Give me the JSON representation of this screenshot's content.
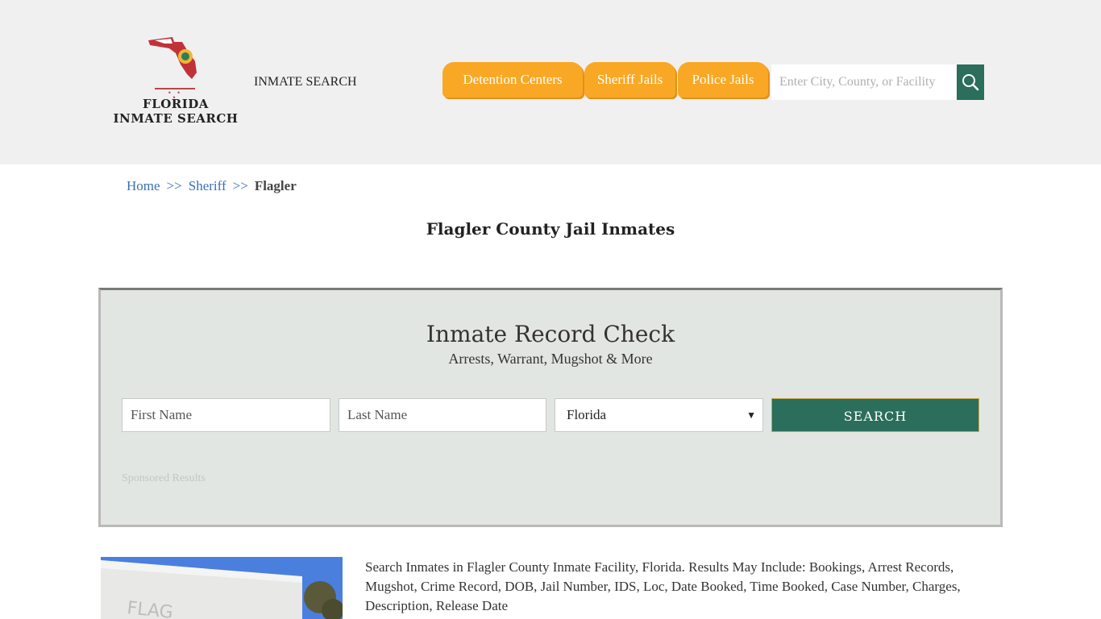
{
  "header": {
    "logo": {
      "line1": "FLORIDA",
      "line2": "INMATE SEARCH",
      "dots": "• • •"
    },
    "nav_link": "INMATE SEARCH",
    "tabs": [
      {
        "label": "Detention Centers"
      },
      {
        "label": "Sheriff Jails"
      },
      {
        "label": "Police Jails"
      }
    ],
    "search": {
      "placeholder": "Enter City, County, or Facility",
      "icon": "search-icon"
    }
  },
  "breadcrumb": {
    "home": "Home",
    "sep1": ">>",
    "sheriff": "Sheriff",
    "sep2": ">>",
    "current": "Flagler"
  },
  "page_title": "Flagler County Jail Inmates",
  "record_check": {
    "title": "Inmate Record Check",
    "subtitle": "Arrests, Warrant, Mugshot & More",
    "first_name_placeholder": "First Name",
    "last_name_placeholder": "Last Name",
    "state_selected": "Florida",
    "search_label": "SEARCH",
    "sponsored": "Sponsored Results"
  },
  "description": "Search Inmates in Flagler County Inmate Facility, Florida. Results May Include: Bookings, Arrest Records, Mugshot, Crime Record, DOB, Jail Number, IDS, Loc, Date Booked, Time Booked, Case Number, Charges, Description, Release Date",
  "colors": {
    "header_bg": "#f0f0f0",
    "tab_orange": "#f9a825",
    "accent_green": "#2a6e5b",
    "link_blue": "#3a6fb7",
    "panel_bg": "#e2e6e2"
  }
}
